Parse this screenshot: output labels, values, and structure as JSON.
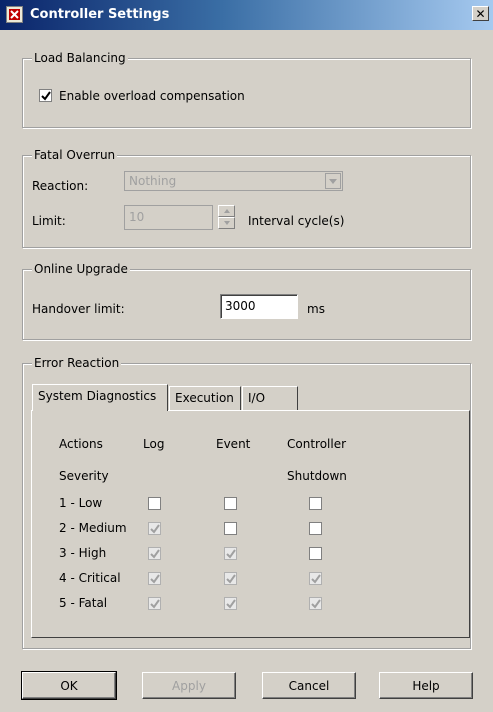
{
  "window": {
    "title": "Controller Settings",
    "close_glyph": "✕"
  },
  "load_balancing": {
    "title": "Load Balancing",
    "overload_label": "Enable overload compensation",
    "overload_checked": true
  },
  "fatal_overrun": {
    "title": "Fatal Overrun",
    "reaction_label": "Reaction:",
    "reaction_value": "Nothing",
    "limit_label": "Limit:",
    "limit_value": "10",
    "limit_unit": "Interval cycle(s)"
  },
  "online_upgrade": {
    "title": "Online Upgrade",
    "handover_label": "Handover limit:",
    "handover_value": "3000",
    "handover_unit": "ms"
  },
  "error_reaction": {
    "title": "Error Reaction",
    "tabs": [
      "System Diagnostics",
      "Execution",
      "I/O"
    ],
    "active_tab": "System Diagnostics",
    "headers": {
      "actions": "Actions",
      "severity": "Severity",
      "log": "Log",
      "event": "Event",
      "controller": "Controller",
      "shutdown": "Shutdown"
    },
    "rows": [
      {
        "severity": "1 - Low",
        "log": false,
        "event": false,
        "shutdown": false,
        "disabled": [
          false,
          false,
          false
        ]
      },
      {
        "severity": "2 - Medium",
        "log": true,
        "event": false,
        "shutdown": false,
        "disabled": [
          true,
          false,
          false
        ]
      },
      {
        "severity": "3 - High",
        "log": true,
        "event": true,
        "shutdown": false,
        "disabled": [
          true,
          true,
          false
        ]
      },
      {
        "severity": "4 - Critical",
        "log": true,
        "event": true,
        "shutdown": true,
        "disabled": [
          true,
          true,
          true
        ]
      },
      {
        "severity": "5 - Fatal",
        "log": true,
        "event": true,
        "shutdown": true,
        "disabled": [
          true,
          true,
          true
        ]
      }
    ]
  },
  "buttons": {
    "ok": "OK",
    "apply": "Apply",
    "cancel": "Cancel",
    "help": "Help"
  }
}
